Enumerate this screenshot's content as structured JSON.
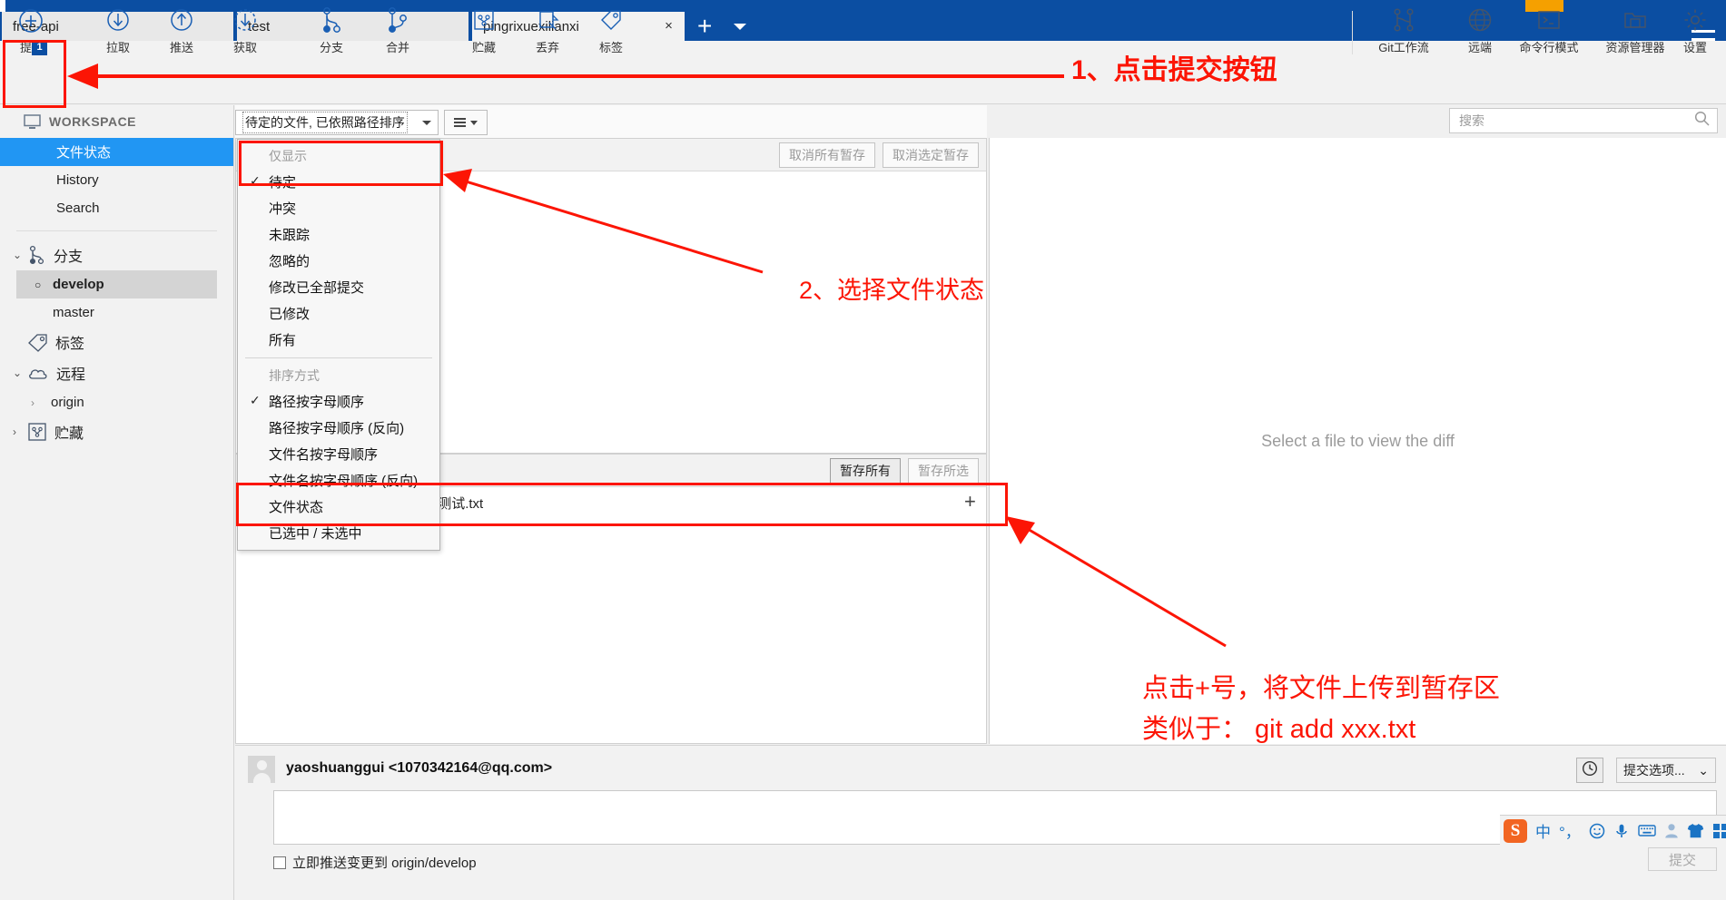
{
  "window": {
    "tabs": [
      {
        "label": "free-api",
        "active": false,
        "closable": false
      },
      {
        "label": "test",
        "active": false,
        "closable": false
      },
      {
        "label": "pingrixuexilianxi",
        "active": true,
        "closable": true,
        "close_glyph": "×"
      }
    ],
    "new_tab_glyph": "+",
    "tab_list_glyph": "▾",
    "menu_icon": "hamburger-icon"
  },
  "toolbar": {
    "left_items": [
      {
        "name": "commit",
        "label": "提交",
        "icon": "plus-circle-icon",
        "badge": "1"
      },
      {
        "name": "pull",
        "label": "拉取",
        "icon": "arrow-down-circle-icon"
      },
      {
        "name": "push",
        "label": "推送",
        "icon": "arrow-up-circle-icon"
      },
      {
        "name": "fetch",
        "label": "获取",
        "icon": "arrow-down-dashed-circle-icon"
      },
      {
        "name": "branch",
        "label": "分支",
        "icon": "branch-icon"
      },
      {
        "name": "merge",
        "label": "合并",
        "icon": "merge-icon"
      },
      {
        "name": "stash",
        "label": "贮藏",
        "icon": "stash-icon"
      },
      {
        "name": "discard",
        "label": "丢弃",
        "icon": "discard-icon"
      },
      {
        "name": "tag",
        "label": "标签",
        "icon": "tag-icon"
      }
    ],
    "right_items": [
      {
        "name": "git-flow",
        "label": "Git工作流",
        "icon": "gitflow-icon"
      },
      {
        "name": "remote",
        "label": "远端",
        "icon": "globe-icon"
      },
      {
        "name": "terminal",
        "label": "命令行模式",
        "icon": "terminal-icon"
      },
      {
        "name": "explorer",
        "label": "资源管理器",
        "icon": "folder-icon"
      },
      {
        "name": "settings",
        "label": "设置",
        "icon": "gear-icon"
      }
    ]
  },
  "sidebar": {
    "workspace_title": "WORKSPACE",
    "workspace_icon": "monitor-icon",
    "workspace_items": [
      {
        "label": "文件状态",
        "selected": true
      },
      {
        "label": "History",
        "selected": false
      },
      {
        "label": "Search",
        "selected": false
      }
    ],
    "groups": [
      {
        "label": "分支",
        "icon": "branch-icon",
        "expanded": true,
        "chevron": "⌄",
        "items": [
          {
            "label": "develop",
            "current": true,
            "bullet": "○"
          },
          {
            "label": "master",
            "current": false
          }
        ]
      },
      {
        "label": "标签",
        "icon": "tag-icon",
        "expanded": false,
        "chevron": "",
        "items": []
      },
      {
        "label": "远程",
        "icon": "cloud-icon",
        "expanded": true,
        "chevron": "⌄",
        "items": [
          {
            "label": "origin",
            "chevron": "›"
          }
        ]
      },
      {
        "label": "贮藏",
        "icon": "stash-icon",
        "expanded": false,
        "chevron": "›",
        "items": []
      }
    ]
  },
  "filter_bar": {
    "combo_value": "待定的文件, 已依照路径排序",
    "list_button_icon": "list-view-icon"
  },
  "dropdown_menu": {
    "section1_title": "仅显示",
    "section1_items": [
      {
        "label": "待定",
        "checked": true,
        "check_glyph": "✓"
      },
      {
        "label": "冲突",
        "checked": false
      },
      {
        "label": "未跟踪",
        "checked": false
      },
      {
        "label": "忽略的",
        "checked": false
      },
      {
        "label": "修改已全部提交",
        "checked": false
      },
      {
        "label": "已修改",
        "checked": false
      },
      {
        "label": "所有",
        "checked": false
      }
    ],
    "section2_title": "排序方式",
    "section2_items": [
      {
        "label": "路径按字母顺序",
        "checked": true,
        "check_glyph": "✓"
      },
      {
        "label": "路径按字母顺序 (反向)",
        "checked": false
      },
      {
        "label": "文件名按字母顺序",
        "checked": false
      },
      {
        "label": "文件名按字母顺序 (反向)",
        "checked": false
      },
      {
        "label": "文件状态",
        "checked": false
      },
      {
        "label": "已选中 / 未选中",
        "checked": false
      }
    ]
  },
  "staged_pane": {
    "unstage_all_label": "取消所有暂存",
    "unstage_selected_label": "取消选定暂存"
  },
  "unstaged_pane": {
    "stage_all_label": "暂存所有",
    "stage_selected_label": "暂存所选",
    "files": [
      {
        "path": "BranchMerge/代码合并冲突测试.txt",
        "status_icon": "modified-pencil-icon",
        "add_glyph": "+"
      }
    ]
  },
  "diff_pane": {
    "empty_message": "Select a file to view the diff"
  },
  "search": {
    "placeholder": "搜索",
    "value": "",
    "icon": "search-icon"
  },
  "commit": {
    "author": "yaoshuanggui <1070342164@qq.com>",
    "avatar_icon": "user-avatar-icon",
    "history_icon": "clock-icon",
    "options_label": "提交选项...",
    "options_caret": "⌄",
    "message_value": "",
    "message_placeholder": "",
    "push_checkbox_label": "立即推送变更到 origin/develop",
    "push_checkbox_checked": false,
    "commit_button_label": "提交"
  },
  "ime": {
    "logo": "S",
    "items": [
      "中",
      "°，",
      "smiley-icon",
      "microphone-icon",
      "keyboard-icon",
      "person-icon",
      "shirt-icon",
      "grid-icon"
    ]
  },
  "annotations": [
    {
      "name": "annotation-step-1",
      "text": "1、点击提交按钮"
    },
    {
      "name": "annotation-step-2",
      "text": "2、选择文件状态"
    },
    {
      "name": "annotation-step-3-line1",
      "text": "点击+号，将文件上传到暂存区"
    },
    {
      "name": "annotation-step-3-line2",
      "text": "类似于： git add xxx.txt"
    }
  ],
  "colors": {
    "title_bar": "#0b4ea2",
    "accent_selected": "#2196f3",
    "annotation_red": "#fc1505",
    "file_status_orange": "#f5a623"
  }
}
